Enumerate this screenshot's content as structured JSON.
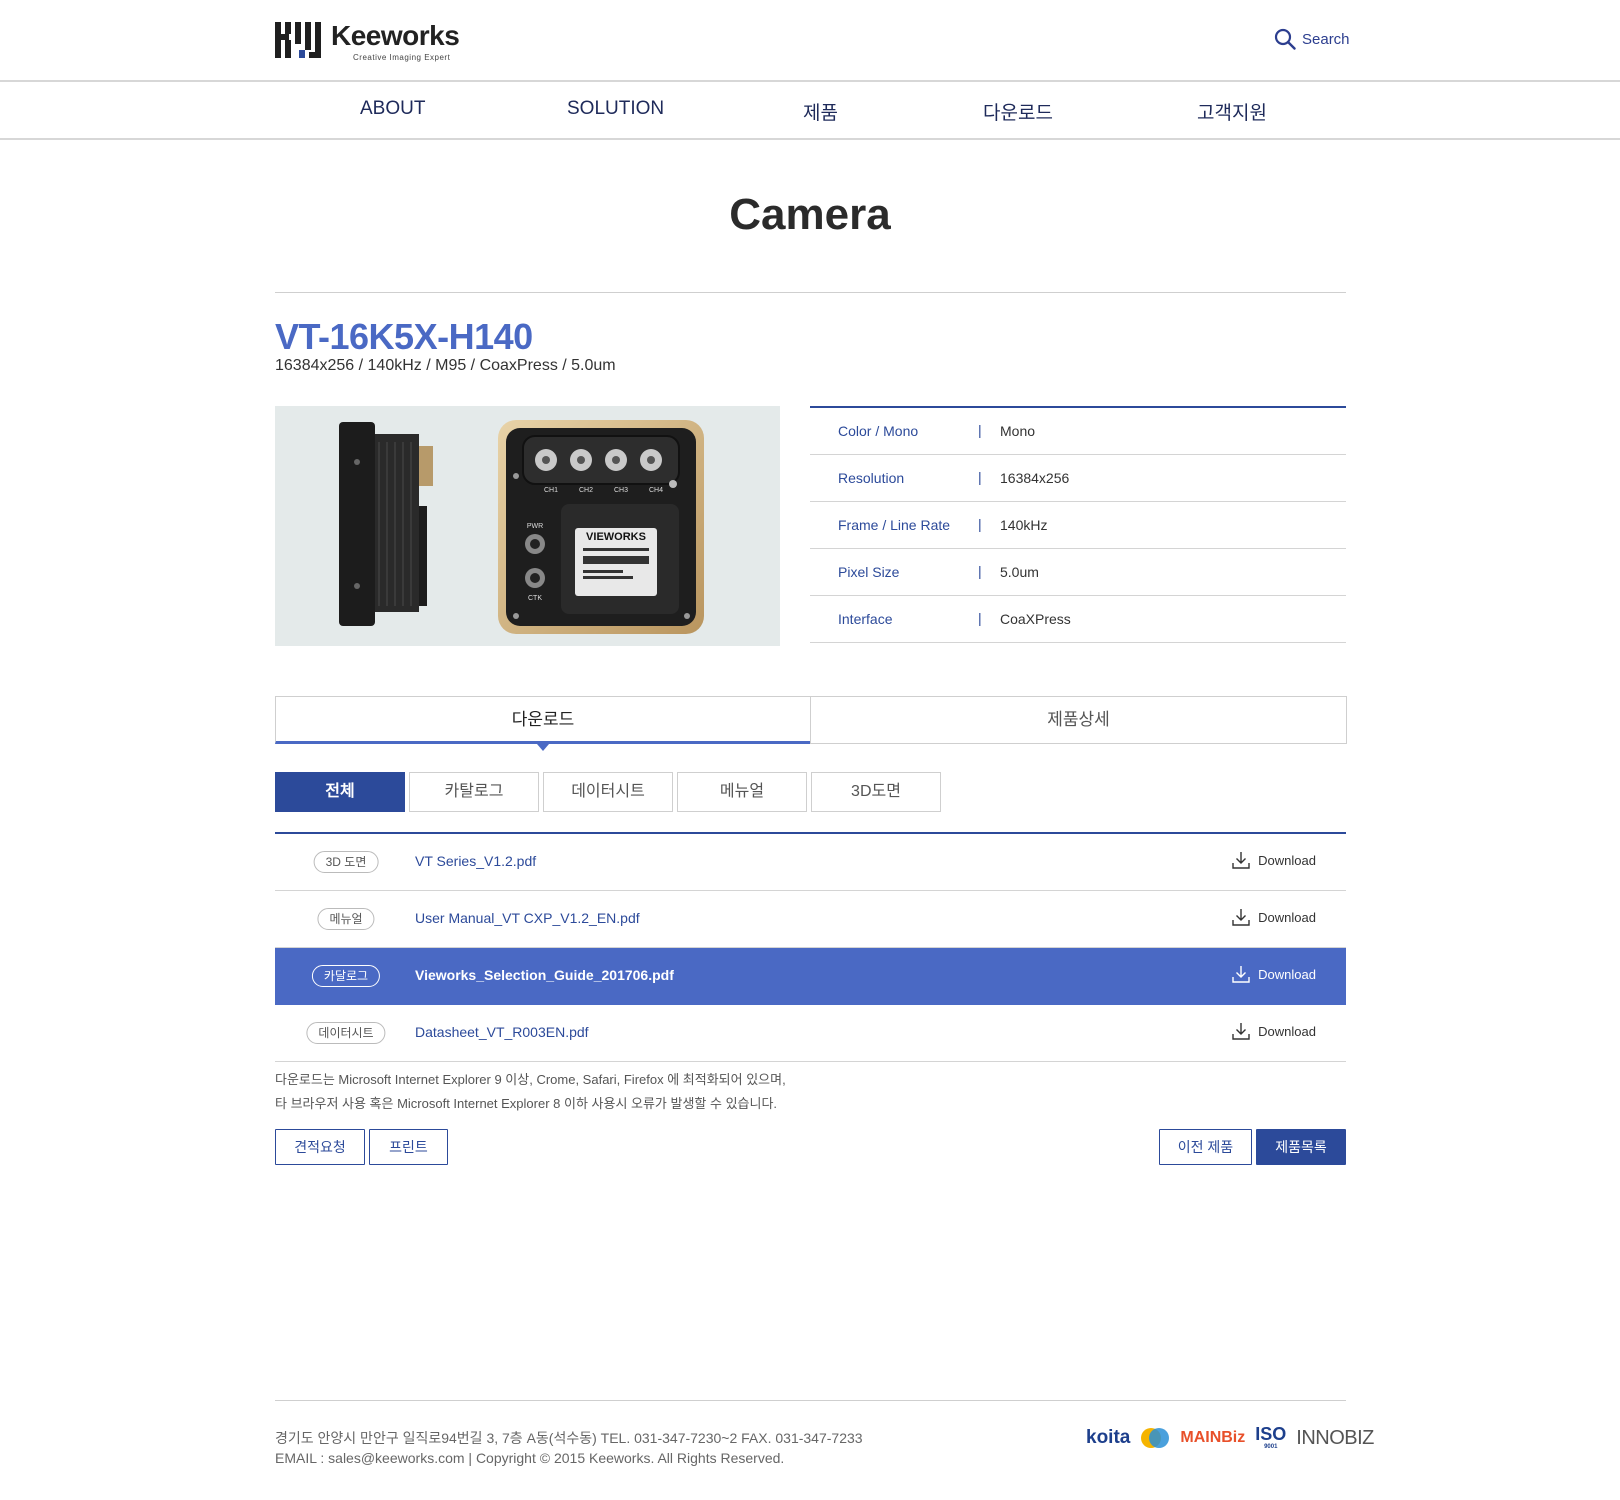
{
  "header": {
    "brand": "Keeworks",
    "tagline": "Creative Imaging Expert",
    "search_label": "Search"
  },
  "nav": [
    "ABOUT",
    "SOLUTION",
    "제품",
    "다운로드",
    "고객지원"
  ],
  "page": {
    "title": "Camera"
  },
  "product": {
    "model": "VT-16K5X-H140",
    "summary": "16384x256 / 140kHz / M95 / CoaxPress / 5.0um",
    "specs": [
      {
        "key": "Color / Mono",
        "value": "Mono"
      },
      {
        "key": "Resolution",
        "value": "16384x256"
      },
      {
        "key": "Frame / Line Rate",
        "value": "140kHz"
      },
      {
        "key": "Pixel Size",
        "value": "5.0um"
      },
      {
        "key": "Interface",
        "value": "CoaXPress"
      }
    ],
    "image_text": {
      "brand": "VIEWORKS",
      "ports": [
        "CH1",
        "CH2",
        "CH3",
        "CH4"
      ],
      "pwr": "PWR",
      "ctk": "CTK"
    }
  },
  "tabs": {
    "download": "다운로드",
    "detail": "제품상세"
  },
  "filters": [
    "전체",
    "카탈로그",
    "데이터시트",
    "메뉴얼",
    "3D도면"
  ],
  "files": [
    {
      "type": "3D 도면",
      "name": "VT Series_V1.2.pdf",
      "action": "Download"
    },
    {
      "type": "메뉴얼",
      "name": "User Manual_VT CXP_V1.2_EN.pdf",
      "action": "Download"
    },
    {
      "type": "카달로그",
      "name": "Vieworks_Selection_Guide_201706.pdf",
      "action": "Download"
    },
    {
      "type": "데이터시트",
      "name": "Datasheet_VT_R003EN.pdf",
      "action": "Download"
    }
  ],
  "note": {
    "line1": "다운로드는 Microsoft Internet Explorer 9 이상, Crome, Safari, Firefox 에 최적화되어 있으며,",
    "line2": "타 브라우저 사용 혹은 Microsoft Internet Explorer 8 이하 사용시 오류가 발생할 수 있습니다."
  },
  "buttons": {
    "quote": "견적요청",
    "print": "프린트",
    "prev": "이전 제품",
    "list": "제품목록"
  },
  "footer": {
    "address": "경기도 안양시 만안구 일직로94번길 3, 7층 A동(석수동)    TEL. 031-347-7230~2  FAX. 031-347-7233",
    "copyright": "EMAIL : sales@keeworks.com | Copyright © 2015 Keeworks. All Rights Reserved.",
    "cert_logos": [
      "koita",
      "MAINBiz",
      "ISO",
      "9001",
      "INNOBIZ"
    ]
  },
  "colors": {
    "accent": "#4a69c4",
    "navy": "#2c4a9a",
    "highlight_row": "#4a69c4"
  }
}
